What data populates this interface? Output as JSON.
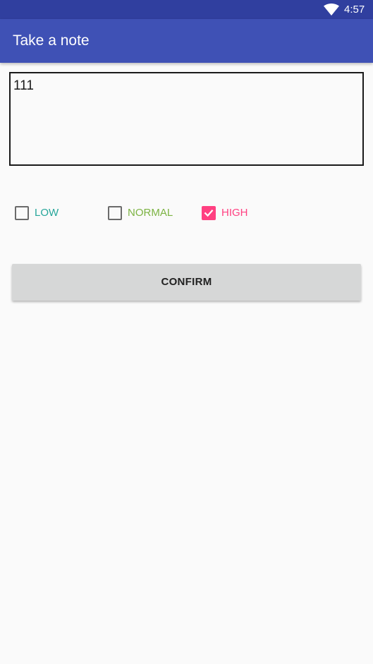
{
  "status_bar": {
    "time": "4:57",
    "wifi_icon": "wifi-icon"
  },
  "app_bar": {
    "title": "Take a note"
  },
  "note": {
    "value": "111"
  },
  "priority": {
    "options": [
      {
        "label": "LOW",
        "checked": false,
        "color": "#26a69a"
      },
      {
        "label": "NORMAL",
        "checked": false,
        "color": "#7cb342"
      },
      {
        "label": "HIGH",
        "checked": true,
        "color": "#ff4081"
      }
    ]
  },
  "confirm_button": {
    "label": "CONFIRM"
  },
  "colors": {
    "status_bar": "#303f9f",
    "app_bar": "#3f51b5",
    "accent": "#ff4081",
    "background": "#fafafa"
  }
}
